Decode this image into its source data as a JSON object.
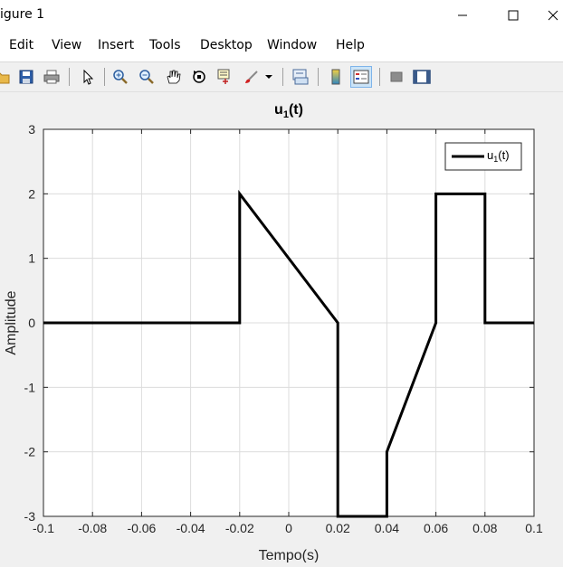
{
  "window": {
    "title": "igure 1",
    "controls": [
      "minimize-icon",
      "maximize-icon",
      "close-icon"
    ]
  },
  "menu": {
    "items": [
      "Edit",
      "View",
      "Insert",
      "Tools",
      "Desktop",
      "Window",
      "Help"
    ]
  },
  "toolbar": {
    "icons": [
      "open-file-icon",
      "save-icon",
      "print-icon",
      "pointer-icon",
      "zoom-in-icon",
      "zoom-out-icon",
      "pan-hand-icon",
      "rotate-3d-icon",
      "data-cursor-icon",
      "brush-icon",
      "brush-dropdown-icon",
      "link-plot-icon",
      "insert-colorbar-icon",
      "insert-legend-icon",
      "hide-plot-tools-icon",
      "show-plot-tools-icon"
    ],
    "pressed": "insert-legend-icon"
  },
  "chart_data": {
    "type": "line",
    "title_main": "u",
    "title_sub": "1",
    "title_suffix": "(t)",
    "xlabel": "Tempo(s)",
    "ylabel": "Amplitude",
    "xlim": [
      -0.1,
      0.1
    ],
    "ylim": [
      -3,
      3
    ],
    "xticks": [
      -0.1,
      -0.08,
      -0.06,
      -0.04,
      -0.02,
      0,
      0.02,
      0.04,
      0.06,
      0.08,
      0.1
    ],
    "xtick_labels": [
      "-0.1",
      "-0.08",
      "-0.06",
      "-0.04",
      "-0.02",
      "0",
      "0.02",
      "0.04",
      "0.06",
      "0.08",
      "0.1"
    ],
    "yticks": [
      -3,
      -2,
      -1,
      0,
      1,
      2,
      3
    ],
    "ytick_labels": [
      "-3",
      "-2",
      "-1",
      "0",
      "1",
      "2",
      "3"
    ],
    "grid": true,
    "legend_position": "top-right",
    "series": [
      {
        "name_main": "u",
        "name_sub": "1",
        "name_suffix": "(t)",
        "color": "#000000",
        "x": [
          -0.1,
          -0.02,
          -0.02,
          0.02,
          0.02,
          0.04,
          0.04,
          0.06,
          0.06,
          0.08,
          0.08,
          0.1
        ],
        "y": [
          0,
          0,
          2,
          0,
          -3,
          -3,
          -2,
          0,
          2,
          2,
          0,
          0
        ]
      }
    ]
  }
}
